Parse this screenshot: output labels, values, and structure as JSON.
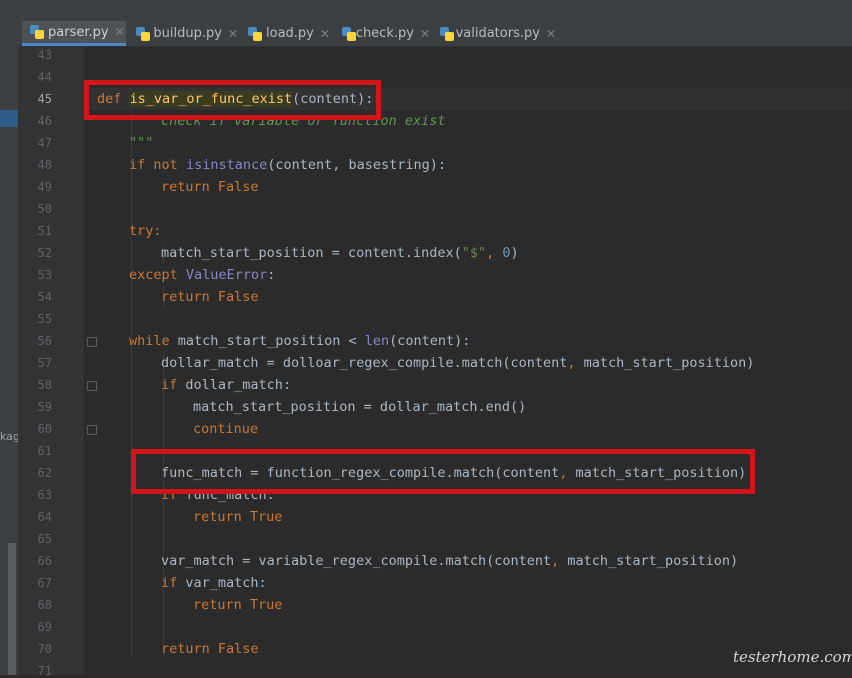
{
  "tabs": [
    {
      "label": "parser.py",
      "active": true
    },
    {
      "label": "buildup.py",
      "active": false
    },
    {
      "label": "load.py",
      "active": false
    },
    {
      "label": "check.py",
      "active": false
    },
    {
      "label": "validators.py",
      "active": false
    }
  ],
  "left_panel_fragment": "kag",
  "line_numbers": [
    "43",
    "44",
    "45",
    "46",
    "47",
    "48",
    "49",
    "50",
    "51",
    "52",
    "53",
    "54",
    "55",
    "56",
    "57",
    "58",
    "59",
    "60",
    "61",
    "62",
    "63",
    "64",
    "65",
    "66",
    "67",
    "68",
    "69",
    "70",
    "71"
  ],
  "code": {
    "l45_def": "def",
    "l45_name": "is_var_or_func_exist",
    "l45_args": "(content):",
    "l46": "check if variable or function exist",
    "l47": "\"\"\"",
    "l48_if": "if",
    "l48_not": "not",
    "l48_isinstance": "isinstance",
    "l48_rest": "(content, basestring):",
    "l49_return": "return",
    "l49_false": "False",
    "l51_try": "try:",
    "l52_a": "match_start_position = content.index(",
    "l52_str": "\"$\"",
    "l52_comma": ", ",
    "l52_num": "0",
    "l52_close": ")",
    "l53_except": "except",
    "l53_err": "ValueError",
    "l53_colon": ":",
    "l54_return": "return",
    "l54_false": "False",
    "l56_while": "while",
    "l56_a": "match_start_position < ",
    "l56_len": "len",
    "l56_b": "(content):",
    "l57_a": "dollar_match = dolloar_regex_compile.match(content",
    "l57_comma": ",",
    "l57_b": " match_start_position)",
    "l58_if": "if",
    "l58_rest": "dollar_match:",
    "l59": "match_start_position = dollar_match.end()",
    "l60": "continue",
    "l62_a": "func_match = function_regex_compile.match(content",
    "l62_comma": ",",
    "l62_b": " match_start_position)",
    "l63_if": "if",
    "l63_rest": "func_match:",
    "l64_return": "return",
    "l64_true": "True",
    "l66_a": "var_match = variable_regex_compile.match(content",
    "l66_comma": ",",
    "l66_b": " match_start_position)",
    "l67_if": "if",
    "l67_rest": "var_match:",
    "l68_return": "return",
    "l68_true": "True",
    "l70_return": "return",
    "l70_false": "False"
  },
  "watermark": "testerhome.com",
  "colors": {
    "keyword": "#cc7832",
    "function": "#ffc66d",
    "builtin": "#8888c6",
    "string": "#6a8759",
    "number": "#6897bb",
    "highlight_box": "#d2151b"
  }
}
